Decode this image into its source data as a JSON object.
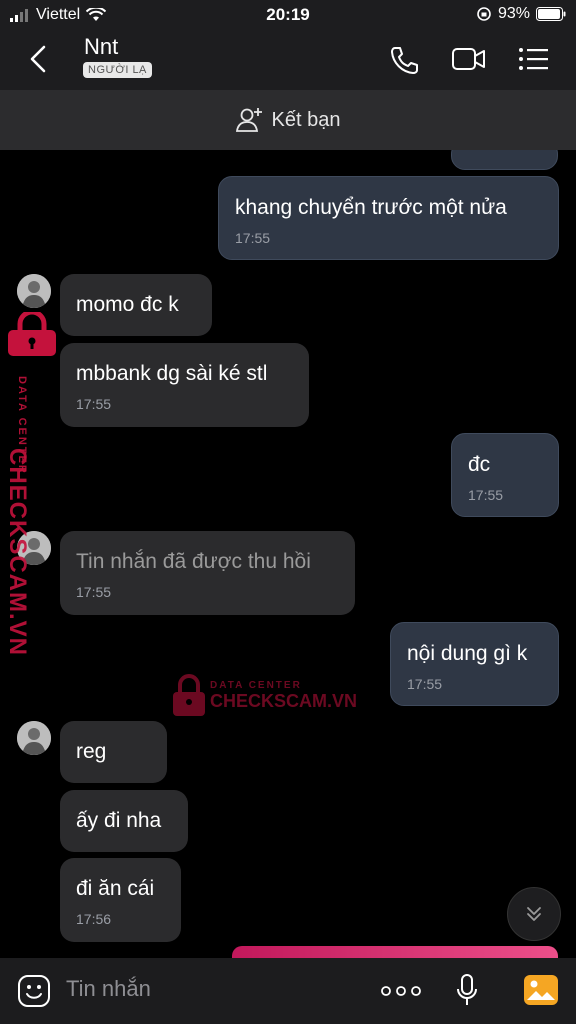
{
  "status_bar": {
    "carrier": "Viettel",
    "time": "20:19",
    "battery": "93%"
  },
  "header": {
    "title": "Nnt",
    "badge": "NGƯỜI LẠ"
  },
  "add_friend": {
    "label": "Kết bạn"
  },
  "messages": [
    {
      "side": "out",
      "text": "khang chuyển trước một nửa",
      "time": "17:55"
    },
    {
      "side": "in",
      "text": "momo đc k",
      "time": ""
    },
    {
      "side": "in",
      "text": "mbbank dg sài ké stl",
      "time": "17:55"
    },
    {
      "side": "out",
      "text": "đc",
      "time": "17:55"
    },
    {
      "side": "in",
      "text": "Tin nhắn đã được thu hồi",
      "time": "17:55",
      "recalled": true
    },
    {
      "side": "out",
      "text": "nội dung gì k",
      "time": "17:55"
    },
    {
      "side": "in",
      "text": "reg",
      "time": ""
    },
    {
      "side": "in",
      "text": "ấy đi nha",
      "time": ""
    },
    {
      "side": "in",
      "text": "đi ăn cái",
      "time": "17:56"
    }
  ],
  "watermark": {
    "line1": "DATA CENTER",
    "line2": "CHECKSCAM.VN"
  },
  "composer": {
    "placeholder": "Tin nhắn"
  },
  "colors": {
    "outgoing_bubble": "#2f3745",
    "incoming_bubble": "#2b2b2d",
    "background": "#000000",
    "watermark": "#c4123c"
  }
}
